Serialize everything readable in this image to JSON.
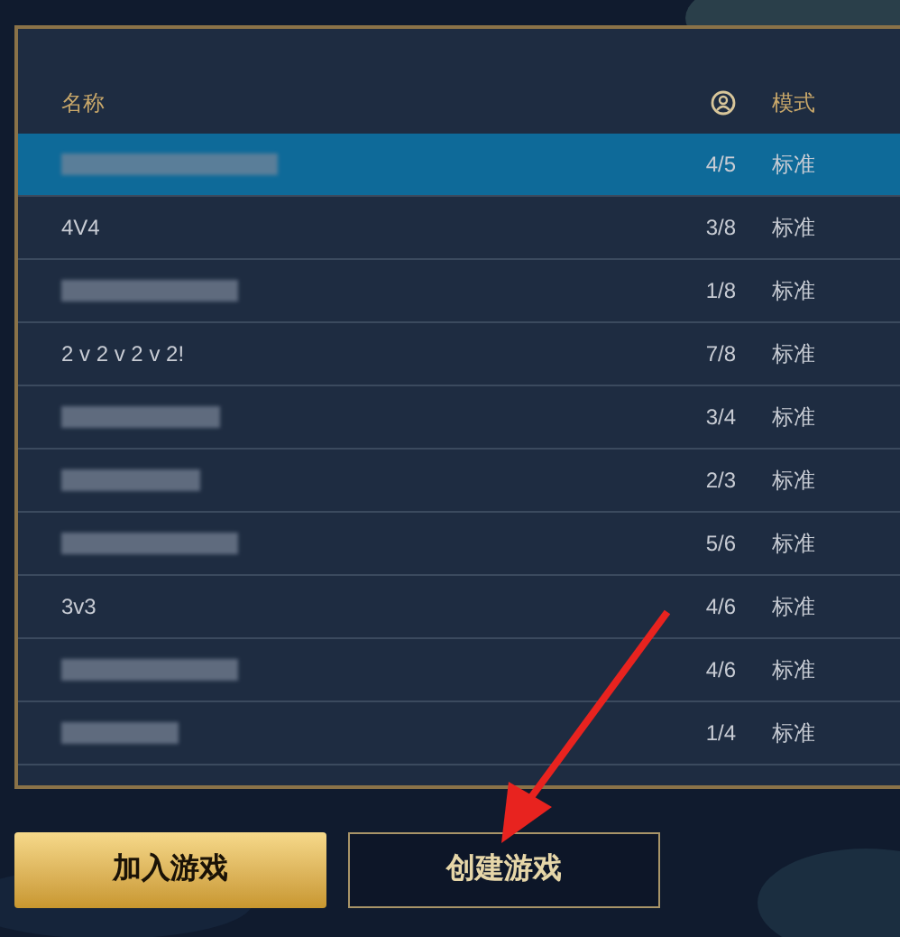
{
  "table": {
    "columns": [
      {
        "kind": "text",
        "label": "名称"
      },
      {
        "kind": "icon"
      },
      {
        "kind": "text",
        "label": "模式"
      }
    ],
    "rows": [
      {
        "kind": "blurred",
        "players": "4/5",
        "mode": "标准",
        "selected": true
      },
      {
        "kind": "text",
        "name": "4V4",
        "players": "3/8",
        "mode": "标准",
        "selected": false
      },
      {
        "kind": "blurred",
        "players": "1/8",
        "mode": "标准",
        "selected": false
      },
      {
        "kind": "text",
        "name": "2 v 2 v 2 v 2!",
        "players": "7/8",
        "mode": "标准",
        "selected": false
      },
      {
        "kind": "blurred",
        "players": "3/4",
        "mode": "标准",
        "selected": false
      },
      {
        "kind": "blurred",
        "players": "2/3",
        "mode": "标准",
        "selected": false
      },
      {
        "kind": "blurred",
        "players": "5/6",
        "mode": "标准",
        "selected": false
      },
      {
        "kind": "text",
        "name": "3v3",
        "players": "4/6",
        "mode": "标准",
        "selected": false
      },
      {
        "kind": "blurred",
        "players": "4/6",
        "mode": "标准",
        "selected": false
      },
      {
        "kind": "blurred",
        "players": "1/4",
        "mode": "标准",
        "selected": false
      }
    ]
  },
  "buttons": [
    {
      "kind": "primary",
      "label": "加入游戏"
    },
    {
      "kind": "secondary",
      "label": "创建游戏"
    }
  ]
}
